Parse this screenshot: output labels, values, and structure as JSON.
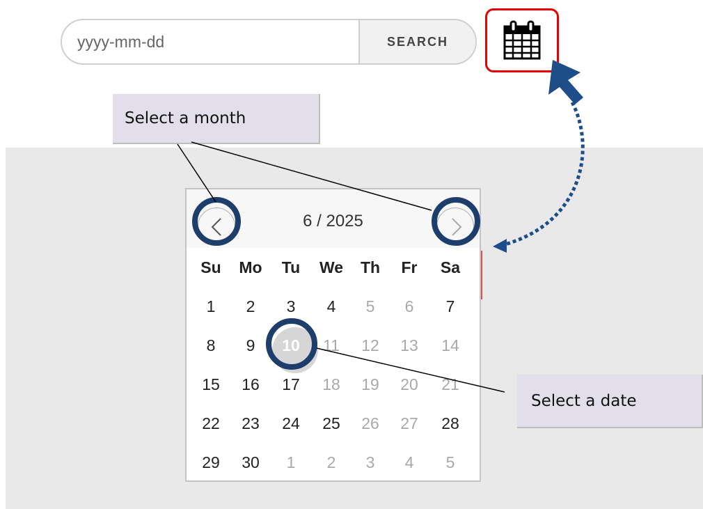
{
  "search": {
    "placeholder": "yyyy-mm-dd",
    "button_label": "SEARCH"
  },
  "calendar_button": {
    "icon": "calendar-icon"
  },
  "callouts": {
    "month": "Select a month",
    "date": "Select a date"
  },
  "datepicker": {
    "title": "6 / 2025",
    "prev_icon": "chevron-left-icon",
    "next_icon": "chevron-right-icon",
    "weekdays": [
      "Su",
      "Mo",
      "Tu",
      "We",
      "Th",
      "Fr",
      "Sa"
    ],
    "weeks": [
      [
        "1",
        "2",
        "3",
        "4",
        "5",
        "6",
        "7"
      ],
      [
        "8",
        "9",
        "10",
        "11",
        "12",
        "13",
        "14"
      ],
      [
        "15",
        "16",
        "17",
        "18",
        "19",
        "20",
        "21"
      ],
      [
        "22",
        "23",
        "24",
        "25",
        "26",
        "27",
        "28"
      ],
      [
        "29",
        "30",
        "1",
        "2",
        "3",
        "4",
        "5"
      ]
    ],
    "selected_date": "10"
  },
  "colors": {
    "highlight_ring": "#1d3d6b",
    "calendar_border": "#e60000",
    "callout_bg": "#e2dfeb",
    "arrow": "#1d4e89"
  }
}
